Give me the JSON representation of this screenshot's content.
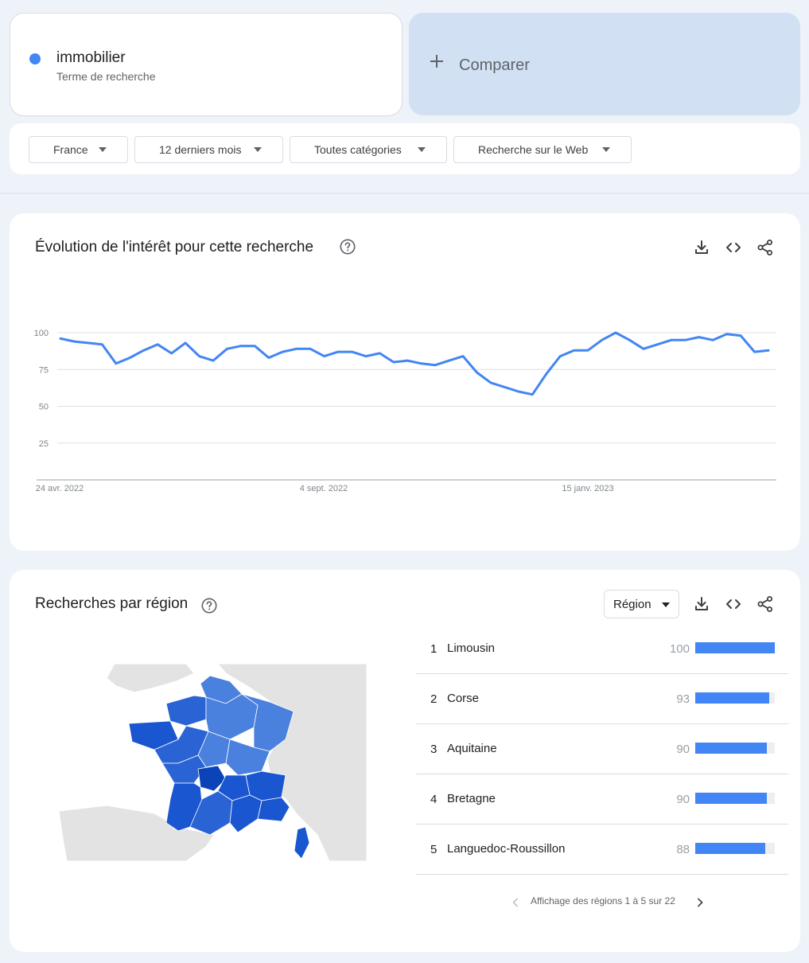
{
  "term": {
    "name": "immobilier",
    "subtitle": "Terme de recherche",
    "color": "#4285f4"
  },
  "compare": {
    "label": "Comparer"
  },
  "filters": [
    {
      "label": "France"
    },
    {
      "label": "12 derniers mois"
    },
    {
      "label": "Toutes catégories"
    },
    {
      "label": "Recherche sur le Web"
    }
  ],
  "interest_section": {
    "title": "Évolution de l'intérêt pour cette recherche",
    "icons": [
      "help-icon",
      "download-icon",
      "embed-icon",
      "share-icon"
    ]
  },
  "chart_data": {
    "type": "line",
    "y_ticks": [
      "100",
      "75",
      "50",
      "25"
    ],
    "ylim": [
      0,
      100
    ],
    "x_tick_labels": [
      "24 avr. 2022",
      "4 sept. 2022",
      "15 janv. 2023"
    ],
    "series": [
      {
        "name": "immobilier",
        "color": "#4285f4",
        "values": [
          96,
          94,
          93,
          92,
          79,
          83,
          88,
          92,
          86,
          93,
          84,
          81,
          89,
          91,
          91,
          83,
          87,
          89,
          89,
          84,
          87,
          87,
          84,
          86,
          80,
          81,
          79,
          78,
          81,
          84,
          73,
          66,
          63,
          60,
          58,
          72,
          84,
          88,
          88,
          95,
          100,
          95,
          89,
          92,
          95,
          95,
          97,
          95,
          99,
          98,
          87,
          88
        ]
      }
    ]
  },
  "region_section": {
    "title": "Recherches par région",
    "dropdown_label": "Région",
    "regions": [
      {
        "rank": "1",
        "name": "Limousin",
        "value": 100
      },
      {
        "rank": "2",
        "name": "Corse",
        "value": 93
      },
      {
        "rank": "3",
        "name": "Aquitaine",
        "value": 90
      },
      {
        "rank": "4",
        "name": "Bretagne",
        "value": 90
      },
      {
        "rank": "5",
        "name": "Languedoc-Roussillon",
        "value": 88
      }
    ],
    "pager_text": "Affichage des régions 1 à 5 sur 22",
    "bar_color": "#4285f4"
  }
}
